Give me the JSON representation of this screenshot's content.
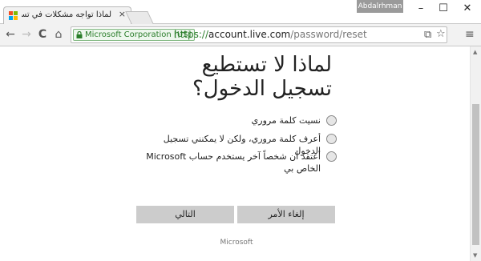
{
  "browser": {
    "tab_title": "لماذا تواجه مشكلات في تسـ",
    "tab_close": "×",
    "user": "Abdalrhman",
    "window_controls": [
      "–",
      "☐",
      "✕"
    ]
  },
  "toolbar": {
    "back_icon": "←",
    "forward_icon": "→",
    "reload_icon": "C",
    "home_icon": "⌂",
    "ev_label": "Microsoft Corporation [US]",
    "url_scheme": "https://",
    "url_host": "account.live.com",
    "url_path": "/password/reset",
    "translate_icon": "⧉",
    "star_icon": "☆",
    "menu_icon": "≡"
  },
  "page": {
    "title": "لماذا لا تستطيع تسجيل الدخول؟",
    "options": [
      "نسيت كلمة مروري",
      "أعرف كلمة مروري، ولكن لا يمكنني تسجيل الدخول",
      "أعتقد أن شخصاً آخر يستخدم حساب Microsoft الخاص بي"
    ],
    "cancel_label": "إلغاء الأمر",
    "next_label": "التالي",
    "footer": "Microsoft"
  },
  "colors": {
    "button_bg": "#cccccc",
    "ev_green": "#2a7d2a",
    "ms_red": "#f25022",
    "ms_green": "#7fba00",
    "ms_blue": "#00a4ef",
    "ms_yellow": "#ffb900"
  }
}
